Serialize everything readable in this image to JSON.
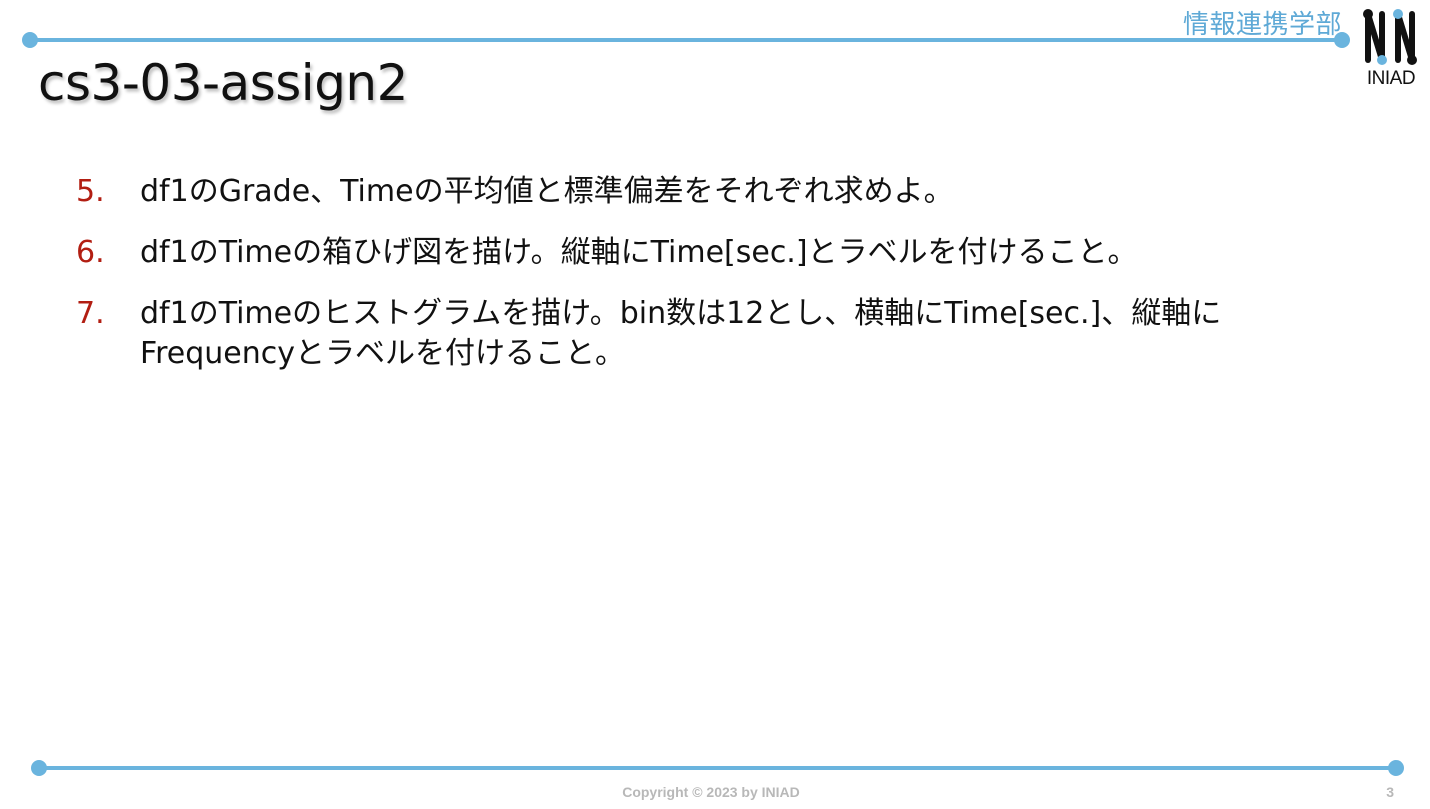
{
  "header": {
    "department": "情報連携学部",
    "logo_text": "INIAD"
  },
  "title": "cs3-03-assign2",
  "items": [
    {
      "number": "5.",
      "text": "df1のGrade、Timeの平均値と標準偏差をそれぞれ求めよ。"
    },
    {
      "number": "6.",
      "text": "df1のTimeの箱ひげ図を描け。縦軸にTime[sec.]とラベルを付けること。"
    },
    {
      "number": "7.",
      "text": "df1のTimeのヒストグラムを描け。bin数は12とし、横軸にTime[sec.]、縦軸に\nFrequencyとラベルを付けること。"
    }
  ],
  "footer": {
    "copyright": "Copyright © 2023 by INIAD",
    "page_number": "3"
  },
  "colors": {
    "accent_line": "#6ab4de",
    "department_text": "#5ea9d6",
    "list_number": "#b21e12",
    "body_text": "#111111",
    "footer_text": "#b8b8b8"
  }
}
